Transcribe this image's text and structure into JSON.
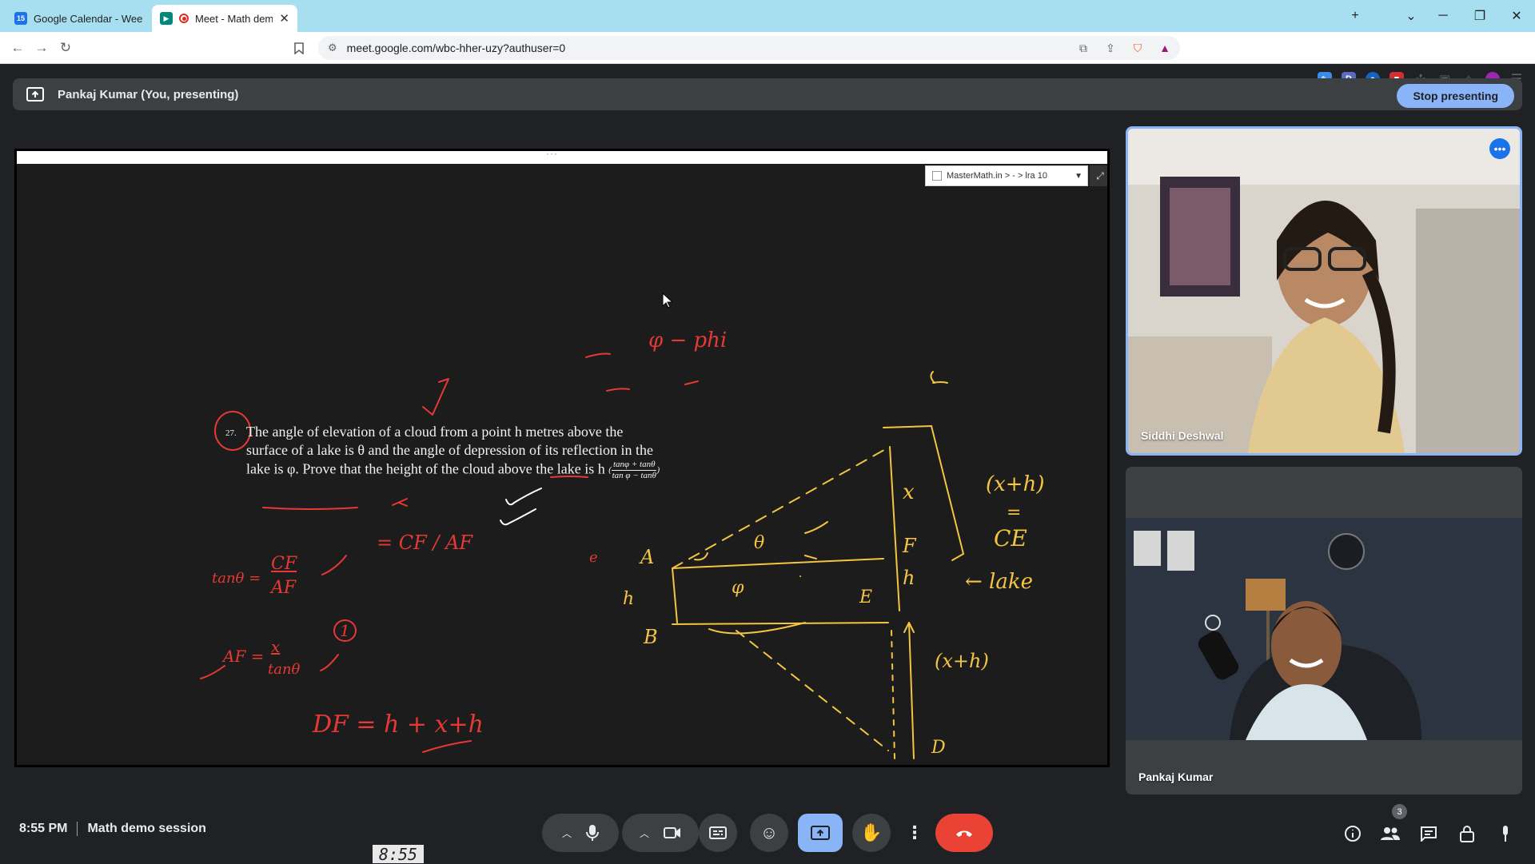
{
  "browser": {
    "tabs": [
      {
        "title": "Google Calendar - Week o",
        "favicon": "calendar-icon",
        "favicon_text": "15",
        "active": false
      },
      {
        "title": "Meet - Math demo",
        "favicon": "meet-icon",
        "active": true
      }
    ],
    "url": "meet.google.com/wbc-hher-uzy?authuser=0"
  },
  "meet": {
    "presenting_text": "Pankaj Kumar (You, presenting)",
    "stop_presenting_label": "Stop presenting",
    "time": "8:55 PM",
    "meeting_title": "Math demo session",
    "clock_widget": "8:55",
    "people_count": "3",
    "participants": [
      {
        "name": "Siddhi Deshwal",
        "speaking": true
      },
      {
        "name": "Pankaj Kumar",
        "speaking": false
      }
    ]
  },
  "shared_screen": {
    "extension_label": "MasterMath.in > - > lra 10",
    "problem_number": "27.",
    "problem_text": "The angle of elevation of a cloud from a point h metres above the surface of a lake is θ and the angle of depression of its reflection in the lake is φ. Prove that the height of the cloud above the lake is h",
    "fraction_numerator": "tanφ + tanθ",
    "fraction_denominator": "tan φ − tanθ",
    "annotations": {
      "phi_label": "φ − phi",
      "eq1_lhs": "tanθ =",
      "eq1_num": "CF",
      "eq1_den": "AF",
      "eq2": "= CF / AF",
      "eq3_lhs": "AF =",
      "eq3_num": "x",
      "eq3_den": "tanθ",
      "eq3_tag": "1",
      "eq4": "DF = h + x+h",
      "small_e": "e",
      "label_A": "A",
      "label_B": "B",
      "label_h_left": "h",
      "label_theta": "θ",
      "label_phi": "φ",
      "label_x": "x",
      "label_F": "F",
      "label_h": "h",
      "label_E": "E",
      "label_D": "D",
      "label_C": "C",
      "xh_top": "(x+h)",
      "equals": "=",
      "CE": "CE",
      "lake": "← lake",
      "xh_bottom": "(x+h)"
    }
  },
  "colors": {
    "meet_blue": "#8ab4f8",
    "end_call_red": "#ea4335",
    "ink_red": "#e53935",
    "ink_yellow": "#f4c542"
  }
}
